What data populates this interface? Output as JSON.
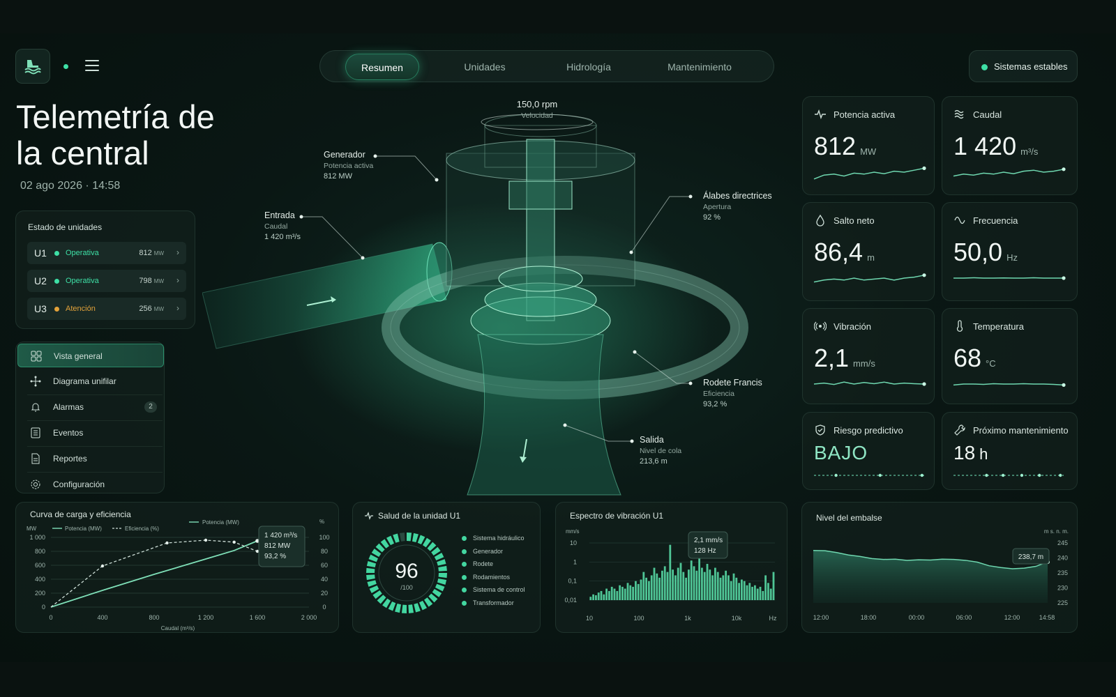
{
  "header": {
    "nav_tabs": [
      {
        "label": "Resumen",
        "active": true
      },
      {
        "label": "Unidades",
        "active": false
      },
      {
        "label": "Hidrología",
        "active": false
      },
      {
        "label": "Mantenimiento",
        "active": false
      }
    ],
    "system_status": "Sistemas estables"
  },
  "page": {
    "title": "Telemetría de la central",
    "datetime": "02 ago 2026 · 14:58"
  },
  "units": {
    "title": "Estado de unidades",
    "rows": [
      {
        "id": "U1",
        "status": "Operativa",
        "value": "812",
        "unit": "MW",
        "color": "#3ee0a6"
      },
      {
        "id": "U2",
        "status": "Operativa",
        "value": "798",
        "unit": "MW",
        "color": "#3ee0a6"
      },
      {
        "id": "U3",
        "status": "Atención",
        "value": "256",
        "unit": "MW",
        "color": "#e3a23a"
      }
    ]
  },
  "side_menu": [
    {
      "label": "Vista general",
      "icon": "grid-icon",
      "active": true
    },
    {
      "label": "Diagrama unifilar",
      "icon": "network-icon"
    },
    {
      "label": "Alarmas",
      "icon": "bell-icon",
      "badge": "2"
    },
    {
      "label": "Eventos",
      "icon": "list-icon"
    },
    {
      "label": "Reportes",
      "icon": "document-icon"
    },
    {
      "label": "Configuración",
      "icon": "gear-icon"
    }
  ],
  "turbine": {
    "speed_value": "150,0 rpm",
    "speed_label": "Velocidad",
    "callouts": {
      "generator": {
        "title": "Generador",
        "sub": "Potencia activa",
        "value": "812 MW"
      },
      "inlet": {
        "title": "Entrada",
        "sub": "Caudal",
        "value": "1 420 m³/s"
      },
      "vanes": {
        "title": "Álabes directrices",
        "sub": "Apertura",
        "value": "92 %"
      },
      "runner": {
        "title": "Rodete Francis",
        "sub": "Eficiencia",
        "value": "93,2 %"
      },
      "outlet": {
        "title": "Salida",
        "sub": "Nivel de cola",
        "value": "213,6 m"
      }
    }
  },
  "metrics": [
    {
      "title": "Potencia activa",
      "icon": "pulse-icon",
      "value": "812",
      "unit": "MW",
      "spark": [
        0.15,
        0.35,
        0.4,
        0.3,
        0.45,
        0.4,
        0.5,
        0.42,
        0.55,
        0.5,
        0.6,
        0.7
      ]
    },
    {
      "title": "Caudal",
      "icon": "waves-icon",
      "value": "1 420",
      "unit": "m³/s",
      "spark": [
        0.3,
        0.4,
        0.35,
        0.45,
        0.4,
        0.5,
        0.42,
        0.55,
        0.6,
        0.5,
        0.55,
        0.65
      ]
    },
    {
      "title": "Salto neto",
      "icon": "droplet-icon",
      "value": "86,4",
      "unit": "m",
      "spark": [
        0.3,
        0.4,
        0.45,
        0.4,
        0.5,
        0.4,
        0.45,
        0.5,
        0.4,
        0.5,
        0.55,
        0.65
      ]
    },
    {
      "title": "Frecuencia",
      "icon": "sine-icon",
      "value": "50,0",
      "unit": "Hz",
      "spark": [
        0.5,
        0.5,
        0.52,
        0.5,
        0.5,
        0.51,
        0.5,
        0.5,
        0.52,
        0.5,
        0.5,
        0.5
      ]
    },
    {
      "title": "Vibración",
      "icon": "vibration-icon",
      "value": "2,1",
      "unit": "mm/s",
      "spark": [
        0.5,
        0.55,
        0.48,
        0.6,
        0.5,
        0.58,
        0.52,
        0.6,
        0.5,
        0.55,
        0.52,
        0.5
      ]
    },
    {
      "title": "Temperatura",
      "icon": "thermometer-icon",
      "value": "68",
      "unit": "°C",
      "spark": [
        0.45,
        0.5,
        0.5,
        0.48,
        0.52,
        0.5,
        0.5,
        0.52,
        0.5,
        0.5,
        0.48,
        0.45
      ]
    },
    {
      "title": "Riesgo predictivo",
      "icon": "shield-icon",
      "value": "BAJO",
      "unit": "",
      "spark": [
        0.5,
        0.5,
        0.5,
        0.5,
        0.5,
        0.5,
        0.5,
        0.5,
        0.5,
        0.5,
        0.5,
        0.5
      ]
    },
    {
      "title": "Próximo mantenimiento",
      "icon": "wrench-icon",
      "value": "18",
      "unit": "h",
      "spark": [
        0.5,
        0.5,
        0.5,
        0.5,
        0.5,
        0.5,
        0.5,
        0.5,
        0.5,
        0.5,
        0.5,
        0.5
      ]
    }
  ],
  "load_chart": {
    "title": "Curva de carga y eficiencia",
    "legend_power": "Potencia (MW)",
    "legend_eff": "Eficiencia (%)",
    "legend_top": "Potencia (MW)",
    "y_left_label": "MW",
    "y_right_label": "%",
    "x_label": "Caudal (m³/s)",
    "tooltip": [
      "1 420 m³/s",
      "812 MW",
      "93,2 %"
    ]
  },
  "health": {
    "title": "Salud de la unidad U1",
    "score": "96",
    "score_max": "/100",
    "items": [
      "Sistema hidráulico",
      "Generador",
      "Rodete",
      "Rodamientos",
      "Sistema de control",
      "Transformador"
    ]
  },
  "spectrum": {
    "title": "Espectro de vibración U1",
    "y_unit": "mm/s",
    "tooltip": [
      "2,1 mm/s",
      "128 Hz"
    ]
  },
  "reservoir": {
    "title": "Nivel del embalse",
    "y_unit": "m s. n. m.",
    "tooltip": "238,7 m"
  },
  "chart_data": [
    {
      "type": "line",
      "title": "Curva de carga y eficiencia",
      "xlabel": "Caudal (m³/s)",
      "ylabel": "MW",
      "y2label": "%",
      "xlim": [
        0,
        2000
      ],
      "ylim": [
        0,
        1000
      ],
      "y2lim": [
        0,
        100
      ],
      "x_ticks": [
        "0",
        "400",
        "800",
        "1 200",
        "1 600",
        "2 000"
      ],
      "y_ticks": [
        "0",
        "200",
        "400",
        "600",
        "800",
        "1 000"
      ],
      "y2_ticks": [
        "0",
        "20",
        "40",
        "60",
        "80",
        "100"
      ],
      "series": [
        {
          "name": "Potencia (MW)",
          "axis": "left",
          "x": [
            0,
            400,
            800,
            1200,
            1420,
            1600
          ],
          "y": [
            0,
            240,
            470,
            690,
            812,
            950
          ]
        },
        {
          "name": "Eficiencia (%)",
          "axis": "right",
          "x": [
            0,
            400,
            900,
            1200,
            1420,
            1600
          ],
          "y": [
            0,
            59,
            92,
            96,
            93.2,
            80
          ]
        }
      ]
    },
    {
      "type": "bar",
      "title": "Espectro de vibración U1",
      "ylabel": "mm/s",
      "y_scale": "log",
      "x_scale": "log",
      "ylim": [
        0.01,
        10
      ],
      "x_ticks": [
        "10",
        "100",
        "1k",
        "10k",
        "Hz"
      ],
      "y_ticks": [
        "10",
        "1",
        "0,1",
        "0,01"
      ],
      "values": [
        0.015,
        0.02,
        0.018,
        0.025,
        0.03,
        0.02,
        0.04,
        0.03,
        0.05,
        0.04,
        0.03,
        0.06,
        0.05,
        0.04,
        0.08,
        0.06,
        0.05,
        0.1,
        0.07,
        0.12,
        0.3,
        0.15,
        0.1,
        0.2,
        0.5,
        0.25,
        0.15,
        0.35,
        0.6,
        0.3,
        8,
        0.4,
        0.2,
        0.5,
        0.9,
        0.3,
        0.15,
        0.4,
        1.2,
        0.6,
        0.35,
        2.1,
        0.5,
        0.3,
        0.8,
        0.4,
        0.2,
        0.5,
        0.3,
        0.15,
        0.2,
        0.35,
        0.2,
        0.1,
        0.25,
        0.15,
        0.08,
        0.12,
        0.1,
        0.06,
        0.08,
        0.05,
        0.06,
        0.04,
        0.05,
        0.03,
        0.2,
        0.08,
        0.04,
        0.3
      ]
    },
    {
      "type": "area",
      "title": "Nivel del embalse",
      "ylabel": "m s. n. m.",
      "ylim": [
        225,
        245
      ],
      "y_ticks": [
        "245",
        "240",
        "235",
        "230",
        "225"
      ],
      "x_ticks": [
        "12:00",
        "18:00",
        "00:00",
        "06:00",
        "12:00",
        "14:58"
      ],
      "values": [
        242.5,
        242.4,
        241.8,
        241.0,
        240.5,
        239.8,
        239.5,
        239.6,
        239.2,
        239.4,
        239.3,
        239.6,
        239.5,
        239.2,
        238.6,
        237.4,
        236.8,
        236.4,
        236.6,
        237.2,
        238.7
      ]
    }
  ]
}
